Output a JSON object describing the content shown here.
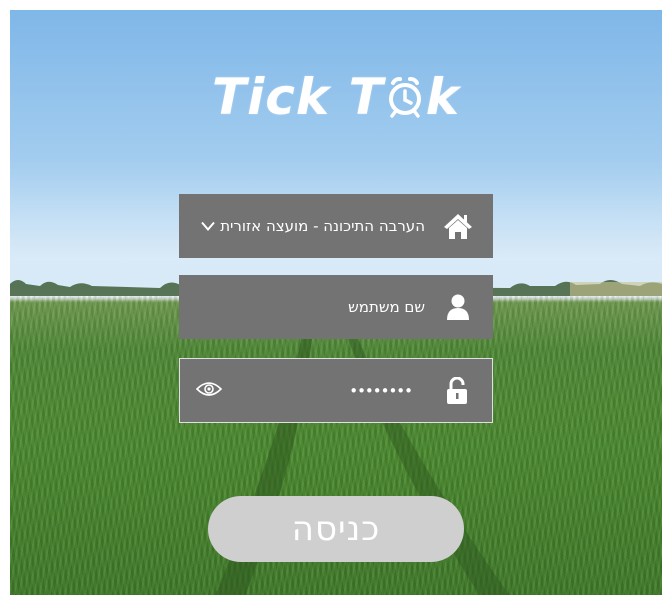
{
  "logo": {
    "text_before": "Tick T",
    "text_after": "k",
    "clock_icon": "alarm-clock-icon"
  },
  "org_field": {
    "value": "הערבה התיכונה - מועצה אזורית",
    "icon": "home-icon",
    "dropdown_icon": "chevron-down-icon"
  },
  "username_field": {
    "placeholder": "שם משתמש",
    "icon": "user-icon"
  },
  "password_field": {
    "value": "••••••••",
    "icon": "lock-icon",
    "toggle_icon": "eye-icon"
  },
  "login_button": {
    "label": "כניסה"
  },
  "colors": {
    "field_bg": "#737373",
    "button_bg": "#cfcfcf",
    "text": "#ffffff"
  }
}
